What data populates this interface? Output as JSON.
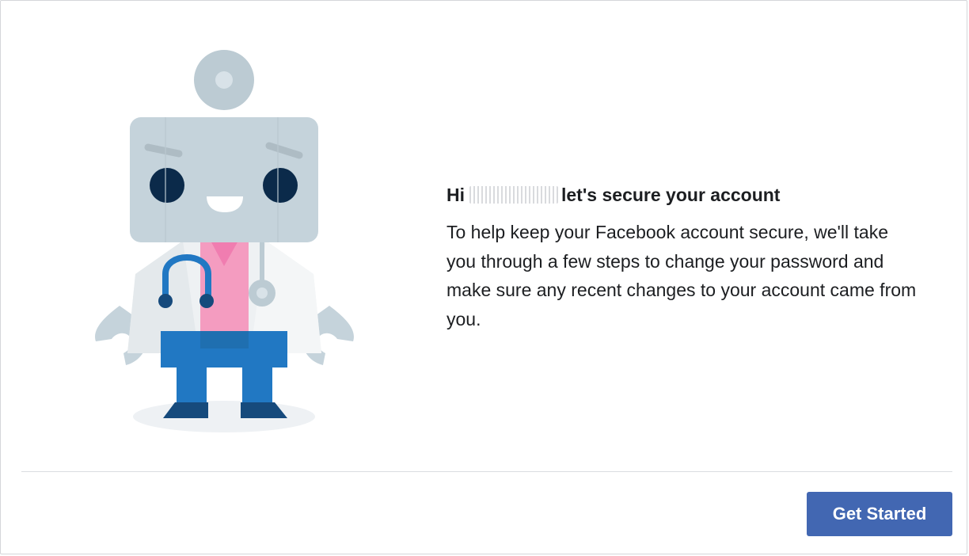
{
  "dialog": {
    "greeting_prefix": "Hi",
    "greeting_suffix": "let's secure your account",
    "body": "To help keep your Facebook account secure, we'll take you through a few steps to change your password and make sure any recent changes to your account came from you.",
    "primary_button_label": "Get Started"
  },
  "colors": {
    "primary_button": "#4267b2",
    "text": "#1c1e21",
    "robot_head": "#c5d3db",
    "robot_shirt": "#f49cc0",
    "robot_pants": "#2178c3",
    "robot_eyes": "#0b2a4a"
  },
  "icons": {
    "illustration": "doctor-robot-illustration"
  }
}
